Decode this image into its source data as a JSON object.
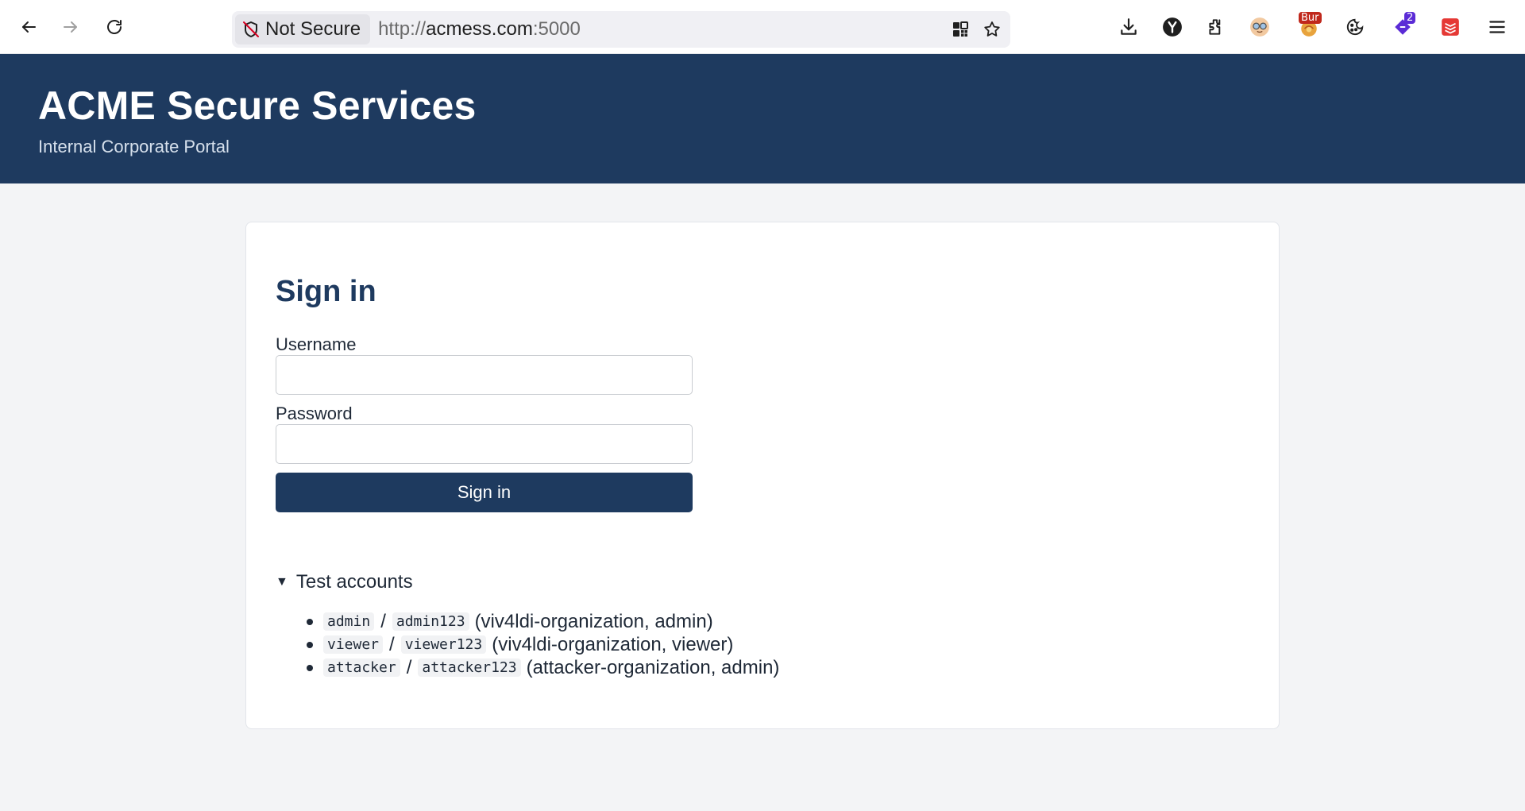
{
  "browser": {
    "security_label": "Not Secure",
    "url_scheme": "http://",
    "url_host": "acmess.com",
    "url_port": ":5000",
    "extension_badges": {
      "bur": "Bur",
      "count": "2"
    },
    "icons": [
      "back-icon",
      "forward-icon",
      "reload-icon",
      "shield-off-icon",
      "qr-grid-icon",
      "star-icon",
      "download-icon",
      "y-icon",
      "puzzle-icon",
      "glasses-icon",
      "burp-icon",
      "cookie-icon",
      "tag-icon",
      "stack-icon",
      "menu-icon"
    ]
  },
  "header": {
    "title": "ACME Secure Services",
    "subtitle": "Internal Corporate Portal",
    "bg_color": "#1e3a5f"
  },
  "signin": {
    "title": "Sign in",
    "username_label": "Username",
    "username_value": "",
    "password_label": "Password",
    "password_value": "",
    "submit_label": "Sign in"
  },
  "test_accounts": {
    "summary": "Test accounts",
    "items": [
      {
        "user": "admin",
        "separator": "/",
        "password": "admin123",
        "note": "(viv4ldi-organization, admin)"
      },
      {
        "user": "viewer",
        "separator": "/",
        "password": "viewer123",
        "note": "(viv4ldi-organization, viewer)"
      },
      {
        "user": "attacker",
        "separator": "/",
        "password": "attacker123",
        "note": "(attacker-organization, admin)"
      }
    ]
  }
}
